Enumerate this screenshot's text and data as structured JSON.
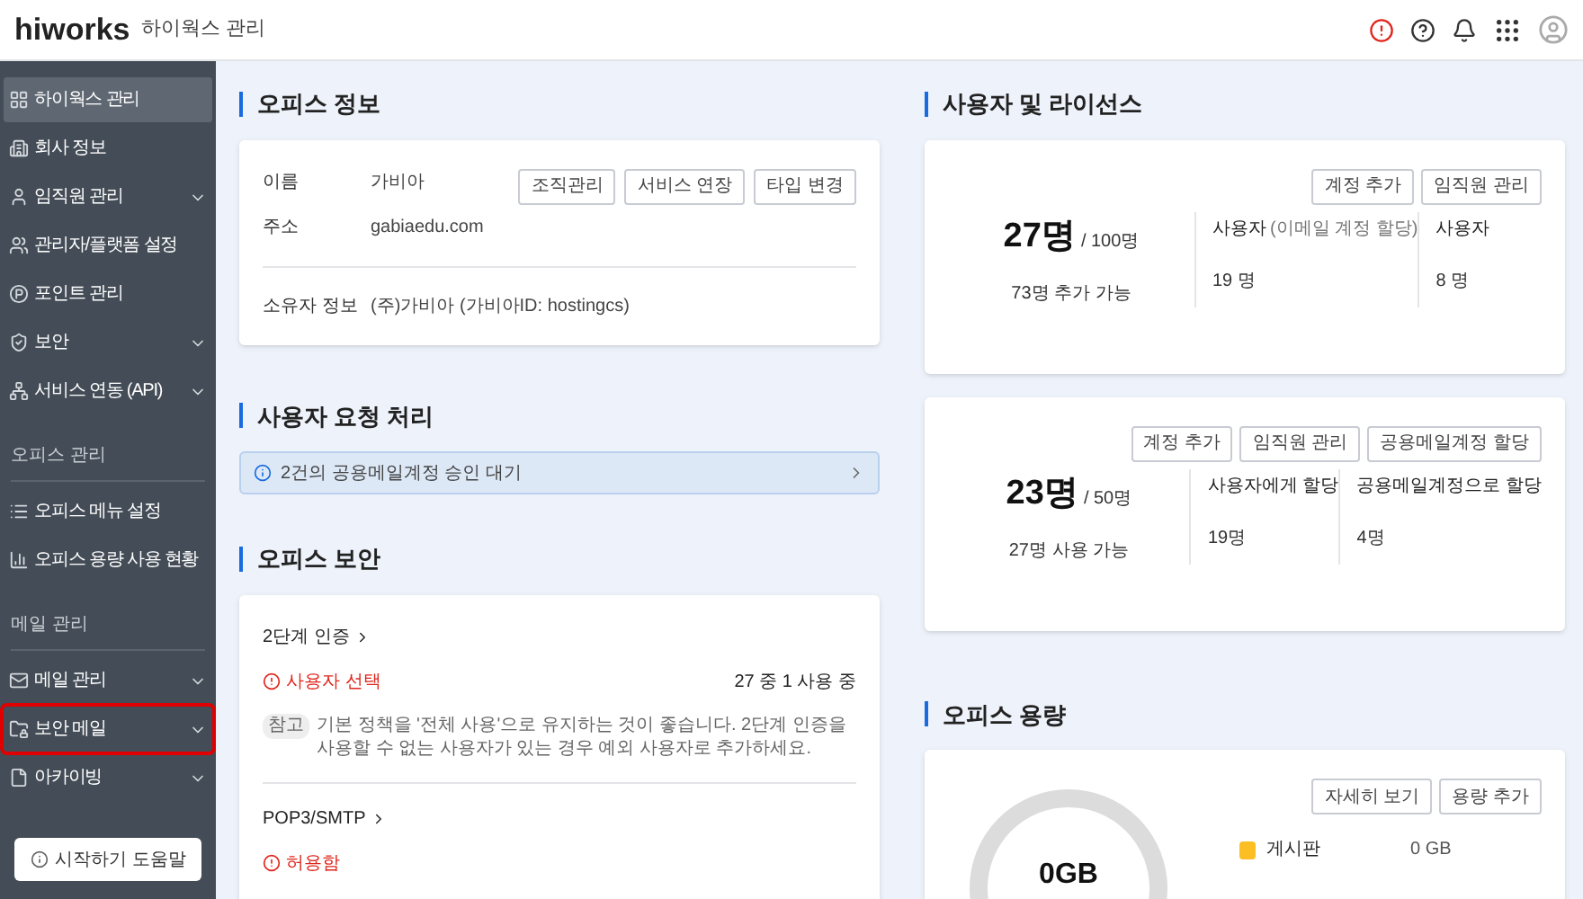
{
  "header": {
    "logo": "hiworks",
    "title": "하이웍스 관리"
  },
  "sidebar": {
    "sections": [
      {
        "items": [
          {
            "label": "하이웍스 관리",
            "selected": true,
            "expandable": false,
            "outlined": false
          },
          {
            "label": "회사 정보",
            "selected": false,
            "expandable": false,
            "outlined": false
          },
          {
            "label": "임직원 관리",
            "selected": false,
            "expandable": true,
            "outlined": false
          },
          {
            "label": "관리자/플랫폼 설정",
            "selected": false,
            "expandable": false,
            "outlined": false
          },
          {
            "label": "포인트 관리",
            "selected": false,
            "expandable": false,
            "outlined": false
          },
          {
            "label": "보안",
            "selected": false,
            "expandable": true,
            "outlined": false
          },
          {
            "label": "서비스 연동 (API)",
            "selected": false,
            "expandable": true,
            "outlined": false
          }
        ]
      },
      {
        "heading": "오피스 관리",
        "items": [
          {
            "label": "오피스 메뉴 설정",
            "selected": false,
            "expandable": false,
            "outlined": false
          },
          {
            "label": "오피스 용량 사용 현황",
            "selected": false,
            "expandable": false,
            "outlined": false
          }
        ]
      },
      {
        "heading": "메일 관리",
        "items": [
          {
            "label": "메일 관리",
            "selected": false,
            "expandable": true,
            "outlined": false
          },
          {
            "label": "보안 메일",
            "selected": false,
            "expandable": true,
            "outlined": true
          },
          {
            "label": "아카이빙",
            "selected": false,
            "expandable": true,
            "outlined": false
          }
        ]
      }
    ],
    "help_button": "시작하기 도움말"
  },
  "office_info": {
    "title": "오피스 정보",
    "rows": [
      {
        "label": "이름",
        "value": "가비아"
      },
      {
        "label": "주소",
        "value": "gabiaedu.com"
      }
    ],
    "buttons": [
      "조직관리",
      "서비스 연장",
      "타입 변경"
    ],
    "owner": {
      "label": "소유자 정보",
      "value": "(주)가비아 (가비아ID: hostingcs)"
    }
  },
  "requests": {
    "title": "사용자 요청 처리",
    "notice": "2건의 공용메일계정 승인 대기"
  },
  "security": {
    "title": "오피스 보안",
    "items": [
      {
        "title": "2단계 인증",
        "status": "사용자 선택",
        "count": "27 중 1 사용 중",
        "note_tag": "참고",
        "note": "기본 정책을 '전체 사용'으로 유지하는 것이 좋습니다. 2단계 인증을 사용할 수 없는 사용자가 있는 경우 예외 사용자로 추가하세요."
      },
      {
        "title": "POP3/SMTP",
        "status": "허용함"
      }
    ]
  },
  "licenses": {
    "title": "사용자 및 라이선스",
    "cards": [
      {
        "buttons": [
          "계정 추가",
          "임직원 관리"
        ],
        "used": "27명",
        "total": "/ 100명",
        "available": "73명 추가 가능",
        "columns": [
          {
            "label": "사용자",
            "note": "(이메일 계정 할당)",
            "value": "19 명"
          },
          {
            "label": "사용자",
            "value": "8 명"
          }
        ]
      },
      {
        "buttons": [
          "계정 추가",
          "임직원 관리",
          "공용메일계정 할당"
        ],
        "used": "23명",
        "total": "/ 50명",
        "available": "27명 사용 가능",
        "columns": [
          {
            "label": "사용자에게 할당",
            "value": "19명"
          },
          {
            "label": "공용메일계정으로 할당",
            "value": "4명"
          }
        ]
      }
    ]
  },
  "storage": {
    "title": "오피스 용량",
    "buttons": [
      "자세히 보기",
      "용량 추가"
    ],
    "total": "0GB",
    "legend": [
      {
        "label": "게시판",
        "color": "#fbbf24",
        "value": "0 GB"
      }
    ]
  }
}
